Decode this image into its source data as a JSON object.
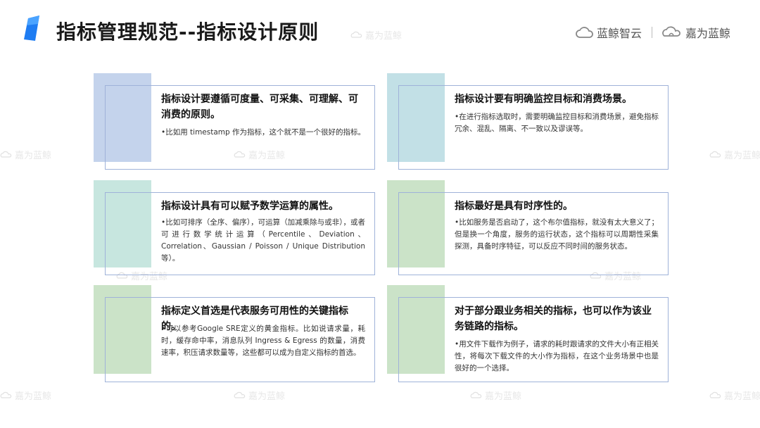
{
  "header": {
    "title": "指标管理规范--指标设计原则",
    "brand_primary": "蓝鲸智云",
    "brand_secondary": "嘉为蓝鲸"
  },
  "watermark": {
    "text": "嘉为蓝鲸"
  },
  "colors": {
    "accent_blue": "#c4d3ec",
    "accent_lightblue": "#c2e0e6",
    "accent_mint": "#c7e6df",
    "accent_green": "#cbe3c8",
    "border": "#9fb2d9",
    "logo_blue": "#1e7cf2"
  },
  "cards": [
    {
      "heading": "指标设计要遵循可度量、可采集、可理解、可消费的原则。",
      "body": "•比如用 timestamp 作为指标，这个就不是一个很好的指标。"
    },
    {
      "heading": "指标设计要有明确监控目标和消费场景。",
      "body": "•在进行指标选取时，需要明确监控目标和消费场景，避免指标冗余、混乱、隔离、不一致以及谬误等。"
    },
    {
      "heading": "指标设计具有可以赋予数学运算的属性。",
      "body": "•比如可排序（全序、偏序），可运算（加减乘除与或非），或者可进行数学统计运算（Percentile、Deviation、Correlation、Gaussian / Poisson / Unique Distribution 等）。"
    },
    {
      "heading": "指标最好是具有时序性的。",
      "body": "•比如服务是否启动了，这个布尔值指标，就没有太大意义了；但是换一个角度，服务的运行状态，这个指标可以周期性采集探测，具备时序特征，可以反应不同时间的服务状态。"
    },
    {
      "heading": "指标定义首选是代表服务可用性的关键指标的。",
      "body": "•可以参考Google SRE定义的黄金指标。比如说请求量，耗时，缓存命中率，消息队列 Ingress & Egress 的数量，消费速率，积压请求数量等，这些都可以成为自定义指标的首选。"
    },
    {
      "heading": "对于部分跟业务相关的指标，也可以作为该业务链路的指标。",
      "body": "•用文件下载作为例子，请求的耗时跟请求的文件大小有正相关性，将每次下载文件的大小作为指标，在这个业务场景中也是很好的一个选择。"
    }
  ]
}
